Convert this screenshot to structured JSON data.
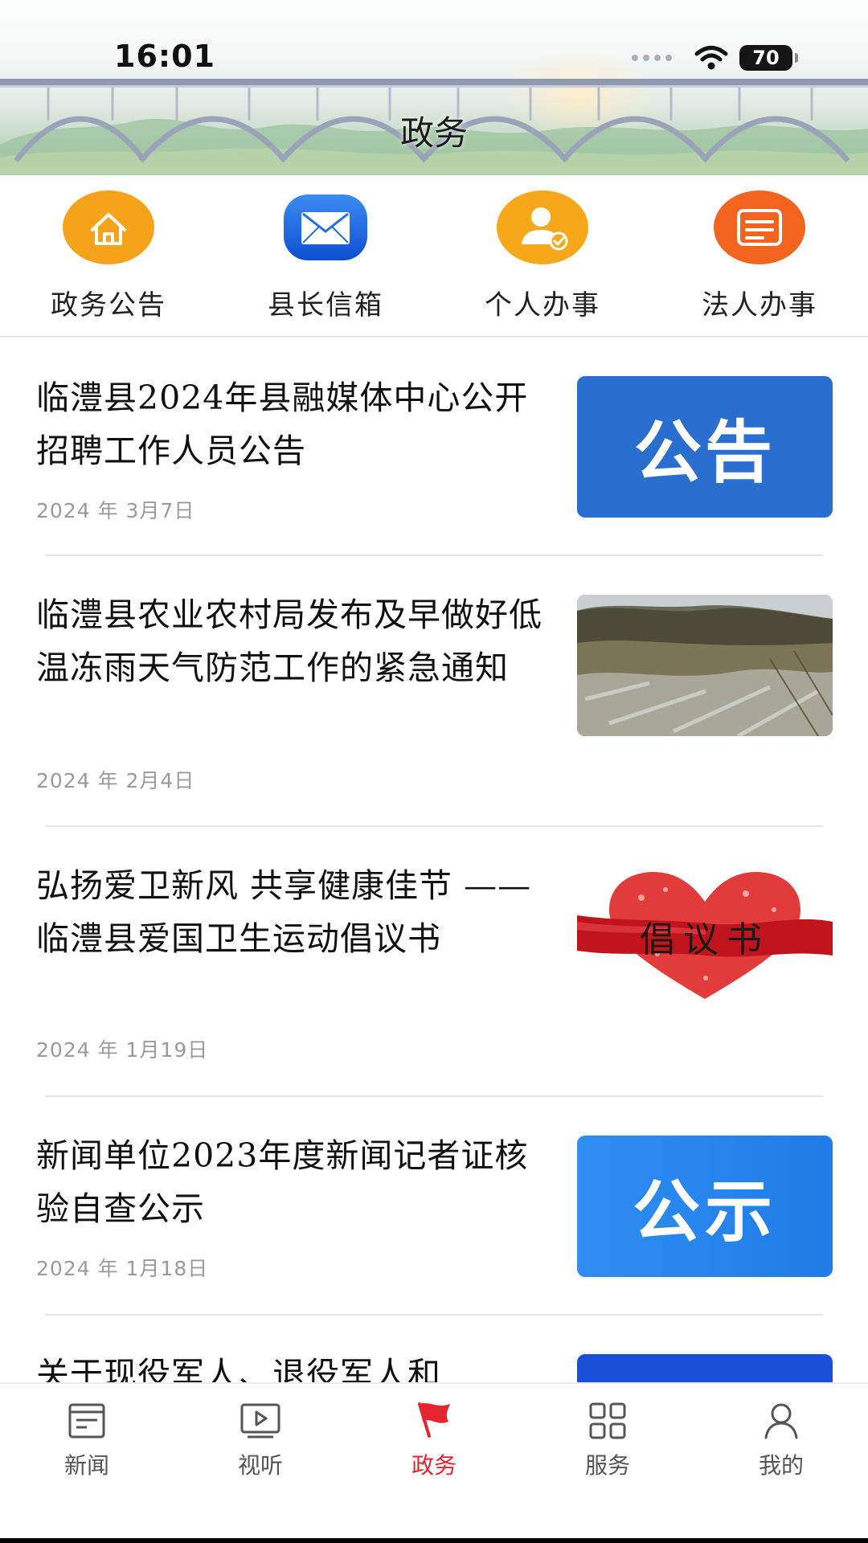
{
  "status_bar": {
    "time": "16:01",
    "battery": "70"
  },
  "header": {
    "title": "政务"
  },
  "quick_entries": [
    {
      "label": "政务公告",
      "icon": "home-icon",
      "color": "#f6a31c"
    },
    {
      "label": "县长信箱",
      "icon": "mail-icon",
      "color": "#1e6fe0"
    },
    {
      "label": "个人办事",
      "icon": "user-check-icon",
      "color": "#f6a81a"
    },
    {
      "label": "法人办事",
      "icon": "document-list-icon",
      "color": "#f3641e"
    }
  ],
  "news": [
    {
      "title": "临澧县2024年县融媒体中心公开招聘工作人员公告",
      "date": "2024 年 3月7日",
      "thumb_text": "公告"
    },
    {
      "title": "临澧县农业农村局发布及早做好低温冻雨天气防范工作的紧急通知",
      "date": "2024 年 2月4日",
      "thumb_text": ""
    },
    {
      "title": "弘扬爱卫新风  共享健康佳节 ——临澧县爱国卫生运动倡议书",
      "date": "2024 年 1月19日",
      "thumb_text": "倡议书"
    },
    {
      "title": "新闻单位2023年度新闻记者证核验自查公示",
      "date": "2024 年 1月18日",
      "thumb_text": "公示"
    },
    {
      "title": "关于现役军人、退役军人和",
      "date": "",
      "thumb_text": ""
    }
  ],
  "tabs": [
    {
      "label": "新闻",
      "icon": "news-icon",
      "active": false
    },
    {
      "label": "视听",
      "icon": "video-icon",
      "active": false
    },
    {
      "label": "政务",
      "icon": "flag-icon",
      "active": true
    },
    {
      "label": "服务",
      "icon": "grid-icon",
      "active": false
    },
    {
      "label": "我的",
      "icon": "person-icon",
      "active": false
    }
  ],
  "colors": {
    "accent": "#e4252e",
    "tab_inactive": "#555555",
    "date_gray": "#9a9a9a"
  }
}
